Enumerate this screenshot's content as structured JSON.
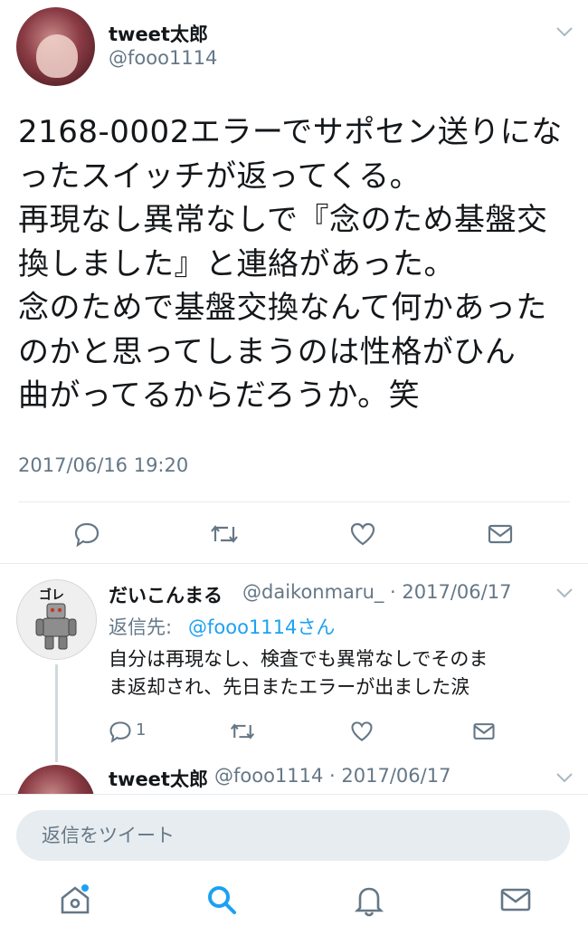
{
  "main_tweet": {
    "display_name": "tweet太郎",
    "handle": "@fooo1114",
    "text": "2168-0002エラーでサポセン送りにな\nったスイッチが返ってくる。\n再現なし異常なしで『念のため基盤交\n換しました』と連絡があった。\n念のためで基盤交換なんて何かあった\nのかと思ってしまうのは性格がひん\n曲がってるからだろうか。笑",
    "timestamp": "2017/06/16 19:20",
    "actions": {
      "reply_icon": "reply-icon",
      "retweet_icon": "retweet-icon",
      "like_icon": "heart-icon",
      "dm_icon": "mail-icon"
    }
  },
  "reply_tweet": {
    "display_name": "だいこんまる",
    "handle_and_date": "@daikonmaru_ · 2017/06/17",
    "replying_label": "返信先:",
    "replying_handle": "@fooo1114さん",
    "text": "自分は再現なし、検査でも異常なしでそのま\nま返却され、先日またエラーが出ました涙",
    "reply_count": "1",
    "avatar_caption": "ゴレ"
  },
  "next_tweet": {
    "display_name": "tweet太郎",
    "handle_and_date": "@fooo1114 · 2017/06/17"
  },
  "composer": {
    "placeholder": "返信をツイート"
  },
  "tabbar": {
    "items": [
      "home-icon",
      "search-icon",
      "notifications-icon",
      "messages-icon"
    ],
    "accent": "#1da1f2"
  }
}
